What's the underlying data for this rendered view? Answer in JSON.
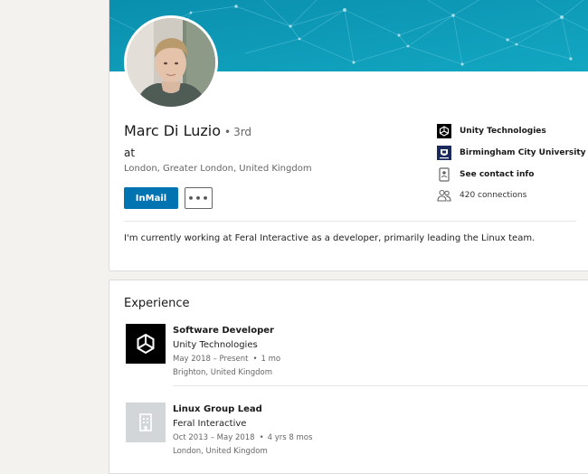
{
  "profile": {
    "name": "Marc Di Luzio",
    "degree_separator": "•",
    "degree": "3rd",
    "headline": "at",
    "location": "London, Greater London, United Kingdom",
    "summary": "I'm currently working at Feral Interactive as a developer, primarily leading the Linux team."
  },
  "actions": {
    "inmail_label": "InMail",
    "more_label": "•••"
  },
  "side_info": {
    "current_company": "Unity Technologies",
    "education": "Birmingham City University",
    "contact_info": "See contact info",
    "connections": "420 connections"
  },
  "experience": {
    "title": "Experience",
    "items": [
      {
        "role": "Software Developer",
        "company": "Unity Technologies",
        "dates": "May 2018 – Present",
        "bullet": "•",
        "duration": "1 mo",
        "location": "Brighton, United Kingdom",
        "logo_icon": "unity-logo-icon"
      },
      {
        "role": "Linux Group Lead",
        "company": "Feral Interactive",
        "dates": "Oct 2013 – May 2018",
        "bullet": "•",
        "duration": "4 yrs 8 mos",
        "location": "London, United Kingdom",
        "logo_icon": "company-placeholder-icon"
      }
    ]
  },
  "colors": {
    "primary_button": "#0073b1",
    "banner": "#0b97b3",
    "page_background": "#f3f2ef"
  }
}
